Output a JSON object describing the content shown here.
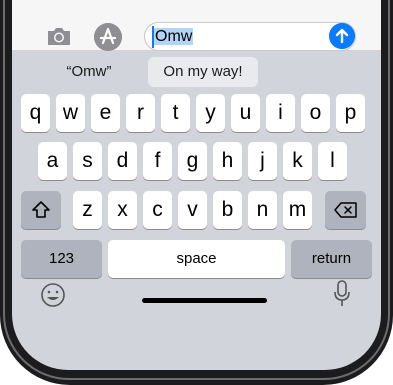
{
  "message_bar": {
    "camera_icon": "camera-icon",
    "apps_icon": "app-store-icon",
    "text_input": {
      "value": "Omw"
    },
    "send_icon": "arrow-up-icon"
  },
  "predictive": {
    "items": [
      "“Omw”",
      "On my way!"
    ]
  },
  "keyboard": {
    "row1": [
      "q",
      "w",
      "e",
      "r",
      "t",
      "y",
      "u",
      "i",
      "o",
      "p"
    ],
    "row2": [
      "a",
      "s",
      "d",
      "f",
      "g",
      "h",
      "j",
      "k",
      "l"
    ],
    "row3": [
      "z",
      "x",
      "c",
      "v",
      "b",
      "n",
      "m"
    ],
    "numbers_label": "123",
    "space_label": "space",
    "return_label": "return",
    "shift_icon": "shift-icon",
    "delete_icon": "delete-icon",
    "emoji_icon": "emoji-icon",
    "dictation_icon": "microphone-icon"
  }
}
